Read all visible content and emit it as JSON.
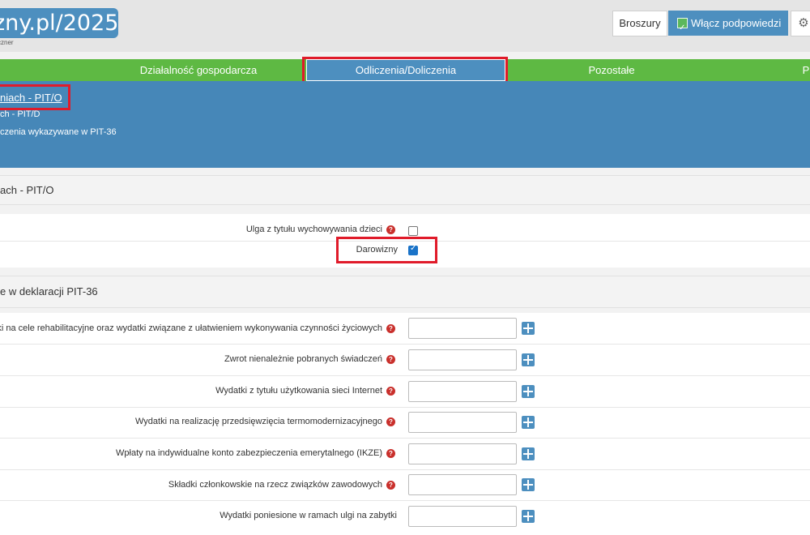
{
  "header": {
    "logo_text": "zny.pl/2025",
    "logo_sub": "czner",
    "broszury_label": "Broszury",
    "hints_label": "Włącz podpowiedzi",
    "hints_enabled": true
  },
  "nav": {
    "tabs": [
      {
        "label": "Działalność gospodarcza",
        "active": false
      },
      {
        "label": "Odliczenia/Doliczenia",
        "active": true
      },
      {
        "label": "Pozostałe",
        "active": false
      },
      {
        "label": "P",
        "active": false
      }
    ]
  },
  "subnav": {
    "item1": "niach - PIT/O",
    "item2": "ch - PIT/D",
    "item3": "czenia wykazywane w PIT-36"
  },
  "section1": {
    "title": "ach - PIT/O",
    "options": [
      {
        "label": "Ulga z tytułu wychowywania dzieci",
        "checked": false,
        "has_help": true
      },
      {
        "label": "Darowizny",
        "checked": true,
        "has_help": false
      }
    ]
  },
  "section2": {
    "title": "e w deklaracji PIT-36",
    "rows": [
      {
        "label": "ki na cele rehabilitacyjne oraz wydatki związane z ułatwieniem wykonywania czynności życiowych",
        "value": ""
      },
      {
        "label": "Zwrot nienależnie pobranych świadczeń",
        "value": ""
      },
      {
        "label": "Wydatki z tytułu użytkowania sieci Internet",
        "value": ""
      },
      {
        "label": "Wydatki na realizację przedsięwzięcia termomodernizacyjnego",
        "value": ""
      },
      {
        "label": "Wpłaty na indywidualne konto zabezpieczenia emerytalnego (IKZE)",
        "value": ""
      },
      {
        "label": "Składki członkowskie na rzecz związków zawodowych",
        "value": ""
      },
      {
        "label": "Wydatki poniesione w ramach ulgi na zabytki",
        "value": ""
      }
    ]
  },
  "colors": {
    "green": "#5eb943",
    "blue": "#4687b8",
    "highlight": "#e01b2a"
  }
}
